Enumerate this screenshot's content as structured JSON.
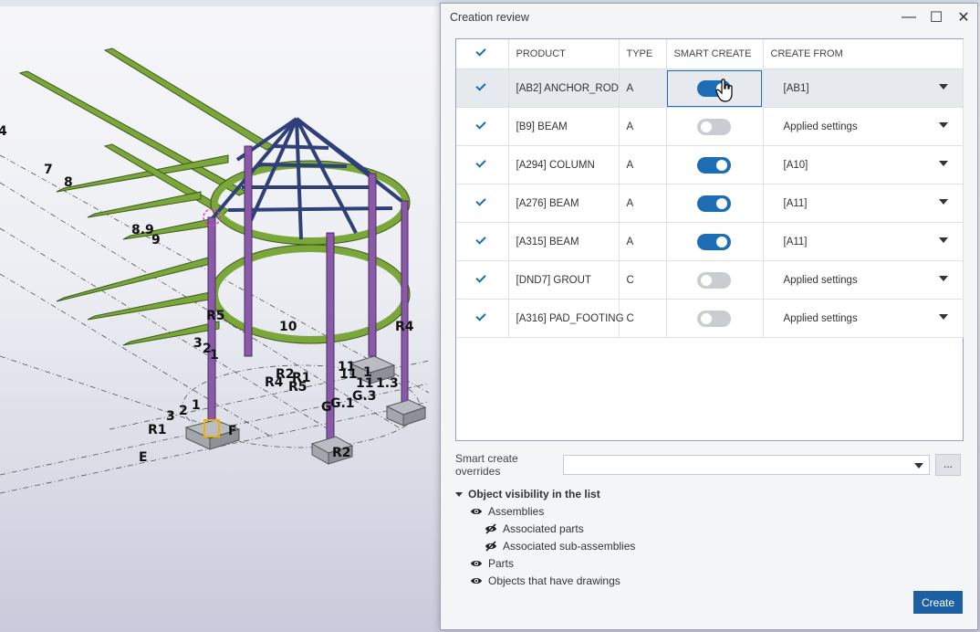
{
  "viewport": {
    "grid_labels": [
      "4",
      "7",
      "8",
      "8.9",
      "9",
      "R5",
      "10",
      "R4",
      "3",
      "2",
      "1",
      "R2",
      "R1",
      "R4",
      "R5",
      "11",
      "11",
      "1",
      "11",
      "1.3",
      "G",
      "G.1",
      "G.3",
      "3",
      "2",
      "1",
      "R1",
      "F",
      "E",
      "R2"
    ]
  },
  "dialog": {
    "title": "Creation review",
    "minimize_glyph": "—",
    "maximize_glyph": "☐",
    "close_glyph": "✕"
  },
  "table": {
    "headers": {
      "product": "PRODUCT",
      "type": "TYPE",
      "smart_create": "SMART CREATE",
      "create_from": "CREATE FROM"
    },
    "rows": [
      {
        "product": "[AB2] ANCHOR_ROD",
        "type": "A",
        "smart": true,
        "create_from": "[AB1]"
      },
      {
        "product": "[B9] BEAM",
        "type": "A",
        "smart": false,
        "create_from": "Applied settings"
      },
      {
        "product": "[A294] COLUMN",
        "type": "A",
        "smart": true,
        "create_from": "[A10]"
      },
      {
        "product": "[A276] BEAM",
        "type": "A",
        "smart": true,
        "create_from": "[A11]"
      },
      {
        "product": "[A315] BEAM",
        "type": "A",
        "smart": true,
        "create_from": "[A11]"
      },
      {
        "product": "[DND7] GROUT",
        "type": "C",
        "smart": false,
        "create_from": "Applied settings"
      },
      {
        "product": "[A316] PAD_FOOTING",
        "type": "C",
        "smart": false,
        "create_from": "Applied settings"
      }
    ]
  },
  "overrides": {
    "label": "Smart create overrides",
    "value": "",
    "more_label": "..."
  },
  "visibility": {
    "header": "Object visibility in the list",
    "items": [
      {
        "label": "Assemblies",
        "level": 1,
        "visible": true
      },
      {
        "label": "Associated parts",
        "level": 2,
        "visible": false
      },
      {
        "label": "Associated sub-assemblies",
        "level": 2,
        "visible": false
      },
      {
        "label": "Parts",
        "level": 1,
        "visible": true
      },
      {
        "label": "Objects that have drawings",
        "level": 1,
        "visible": true
      }
    ]
  },
  "create_label": "Create",
  "colors": {
    "accent": "#1d6db5",
    "beam_green": "#7aa63a",
    "column_purple": "#8a5aa8",
    "roof_navy": "#2f3f78"
  }
}
